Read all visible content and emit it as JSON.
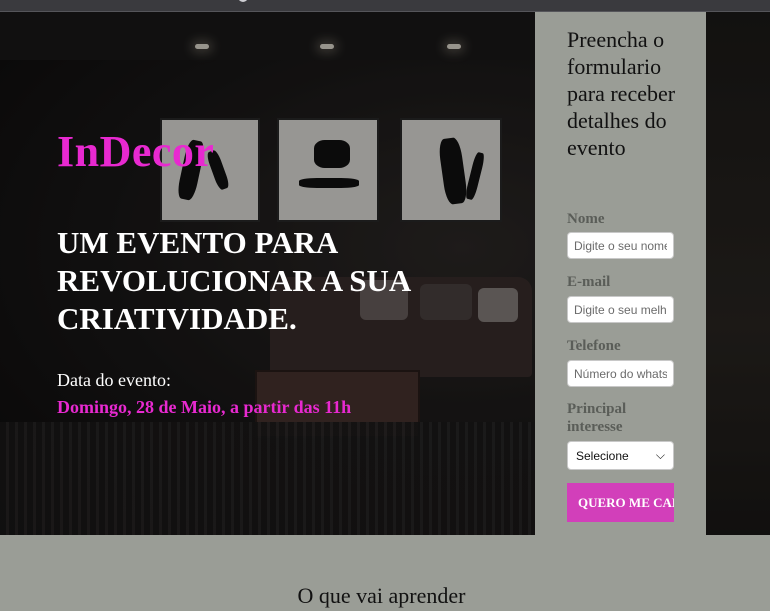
{
  "hero": {
    "brand": "InDecor",
    "headline": "UM EVENTO PARA REVOLUCIONAR A SUA CRIATIVIDADE.",
    "date_label": "Data do evento:",
    "date_value": "Domingo, 28 de Maio, a partir das 11h",
    "brand_color": "#e829d0"
  },
  "form": {
    "title": "Preencha o formulario para receber detalhes do evento",
    "name_label": "Nome",
    "name_placeholder": "Digite o seu nome",
    "email_label": "E-mail",
    "email_placeholder": "Digite o seu melhor e-mail",
    "phone_label": "Telefone",
    "phone_placeholder": "Número do whatsapp",
    "interest_label": "Principal interesse",
    "interest_selected": "Selecione",
    "submit_label": "QUERO ME CADASTRAR",
    "button_color": "#d23fba"
  },
  "section": {
    "title": "O que vai aprender"
  }
}
